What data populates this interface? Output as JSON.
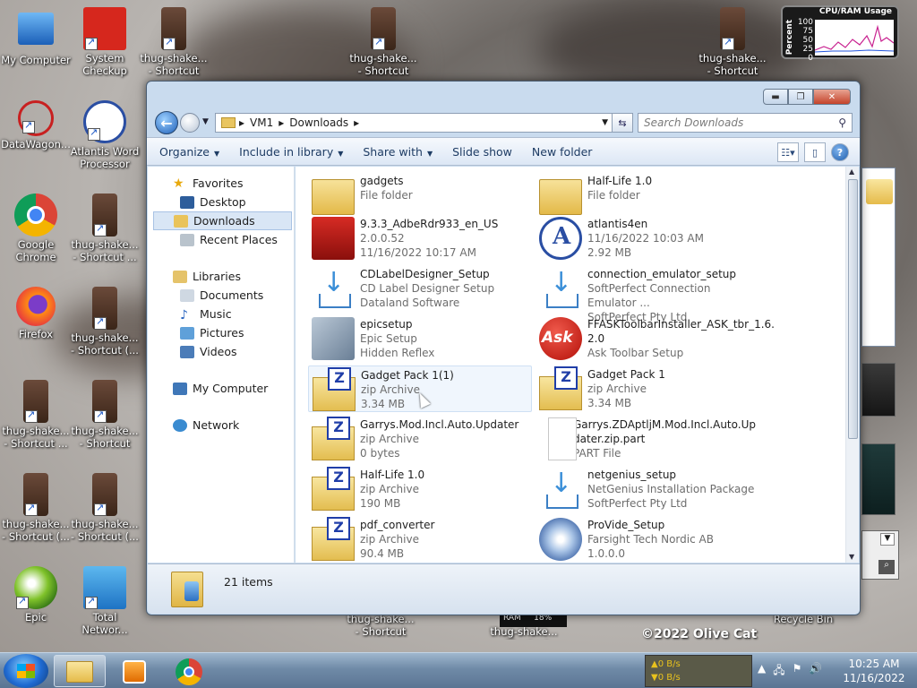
{
  "desktop": {
    "icons": [
      {
        "label": "My Computer"
      },
      {
        "label": "System Checkup"
      },
      {
        "label": "thug-shake... - Shortcut"
      },
      {
        "label": "thug-shake... - Shortcut"
      },
      {
        "label": "thug-shake... - Shortcut"
      },
      {
        "label": "DataWagon..."
      },
      {
        "label": "Atlantis Word Processor"
      },
      {
        "label": "Google Chrome"
      },
      {
        "label": "thug-shake... - Shortcut ..."
      },
      {
        "label": "Firefox"
      },
      {
        "label": "thug-shake... - Shortcut (..."
      },
      {
        "label": "thug-shake... - Shortcut ..."
      },
      {
        "label": "thug-shake... - Shortcut"
      },
      {
        "label": "thug-shake... - Shortcut (..."
      },
      {
        "label": "thug-shake... - Shortcut (..."
      },
      {
        "label": "Epic"
      },
      {
        "label": "Total Networ..."
      },
      {
        "label": "thug-shake... - Shortcut"
      },
      {
        "label": "thug-shake... - Shortcut"
      },
      {
        "label": "Recycle Bin"
      }
    ],
    "gadget": {
      "title": "CPU/RAM Usage",
      "axis_label": "Percent",
      "ticks": [
        "100",
        "75",
        "50",
        "25",
        "0"
      ]
    },
    "ram_gadget": {
      "label": "RAM",
      "value": "18%"
    },
    "watermark": "©2022 Olive Cat"
  },
  "window": {
    "caption_buttons": {
      "min": "▬",
      "max": "❐",
      "close": "✕"
    },
    "address": {
      "parts": [
        "VM1",
        "Downloads"
      ]
    },
    "search_placeholder": "Search Downloads",
    "toolbar": {
      "organize": "Organize",
      "include": "Include in library",
      "share": "Share with",
      "slideshow": "Slide show",
      "newfolder": "New folder"
    },
    "nav": {
      "favorites": "Favorites",
      "desktop": "Desktop",
      "downloads": "Downloads",
      "recent": "Recent Places",
      "libraries": "Libraries",
      "documents": "Documents",
      "music": "Music",
      "pictures": "Pictures",
      "videos": "Videos",
      "computer": "My Computer",
      "network": "Network"
    },
    "files": [
      {
        "name": "gadgets",
        "l2": "File folder",
        "l3": ""
      },
      {
        "name": "Half-Life 1.0",
        "l2": "File folder",
        "l3": ""
      },
      {
        "name": "9.3.3_AdbeRdr933_en_US",
        "l2": "2.0.0.52",
        "l3": "11/16/2022 10:17 AM"
      },
      {
        "name": "atlantis4en",
        "l2": "11/16/2022 10:03 AM",
        "l3": "2.92 MB"
      },
      {
        "name": "CDLabelDesigner_Setup",
        "l2": "CD Label Designer Setup",
        "l3": "Dataland Software"
      },
      {
        "name": "connection_emulator_setup",
        "l2": "SoftPerfect Connection Emulator ...",
        "l3": "SoftPerfect Pty Ltd"
      },
      {
        "name": "epicsetup",
        "l2": "Epic Setup",
        "l3": "Hidden Reflex"
      },
      {
        "name": "FFASKToolbarInstaller_ASK_tbr_1.6.",
        "name2": "2.0",
        "l2": "Ask Toolbar Setup"
      },
      {
        "name": "Gadget Pack 1(1)",
        "l2": "zip Archive",
        "l3": "3.34 MB"
      },
      {
        "name": "Gadget Pack 1",
        "l2": "zip Archive",
        "l3": "3.34 MB"
      },
      {
        "name": "Garrys.Mod.Incl.Auto.Updater",
        "l2": "zip Archive",
        "l3": "0 bytes"
      },
      {
        "name": "Garrys.ZDAptljM.Mod.Incl.Auto.Up",
        "name2": "dater.zip.part",
        "l2": "PART File"
      },
      {
        "name": "Half-Life 1.0",
        "l2": "zip Archive",
        "l3": "190 MB"
      },
      {
        "name": "netgenius_setup",
        "l2": "NetGenius Installation Package",
        "l3": "SoftPerfect Pty Ltd"
      },
      {
        "name": "pdf_converter",
        "l2": "zip Archive",
        "l3": "90.4 MB"
      },
      {
        "name": "ProVide_Setup",
        "l2": "Farsight Tech Nordic AB",
        "l3": "1.0.0.0"
      }
    ],
    "status_count": "21 items"
  },
  "taskbar": {
    "netmon": {
      "up": "▲0 B/s",
      "down": "▼0 B/s"
    },
    "clock": {
      "time": "10:25 AM",
      "date": "11/16/2022"
    }
  }
}
